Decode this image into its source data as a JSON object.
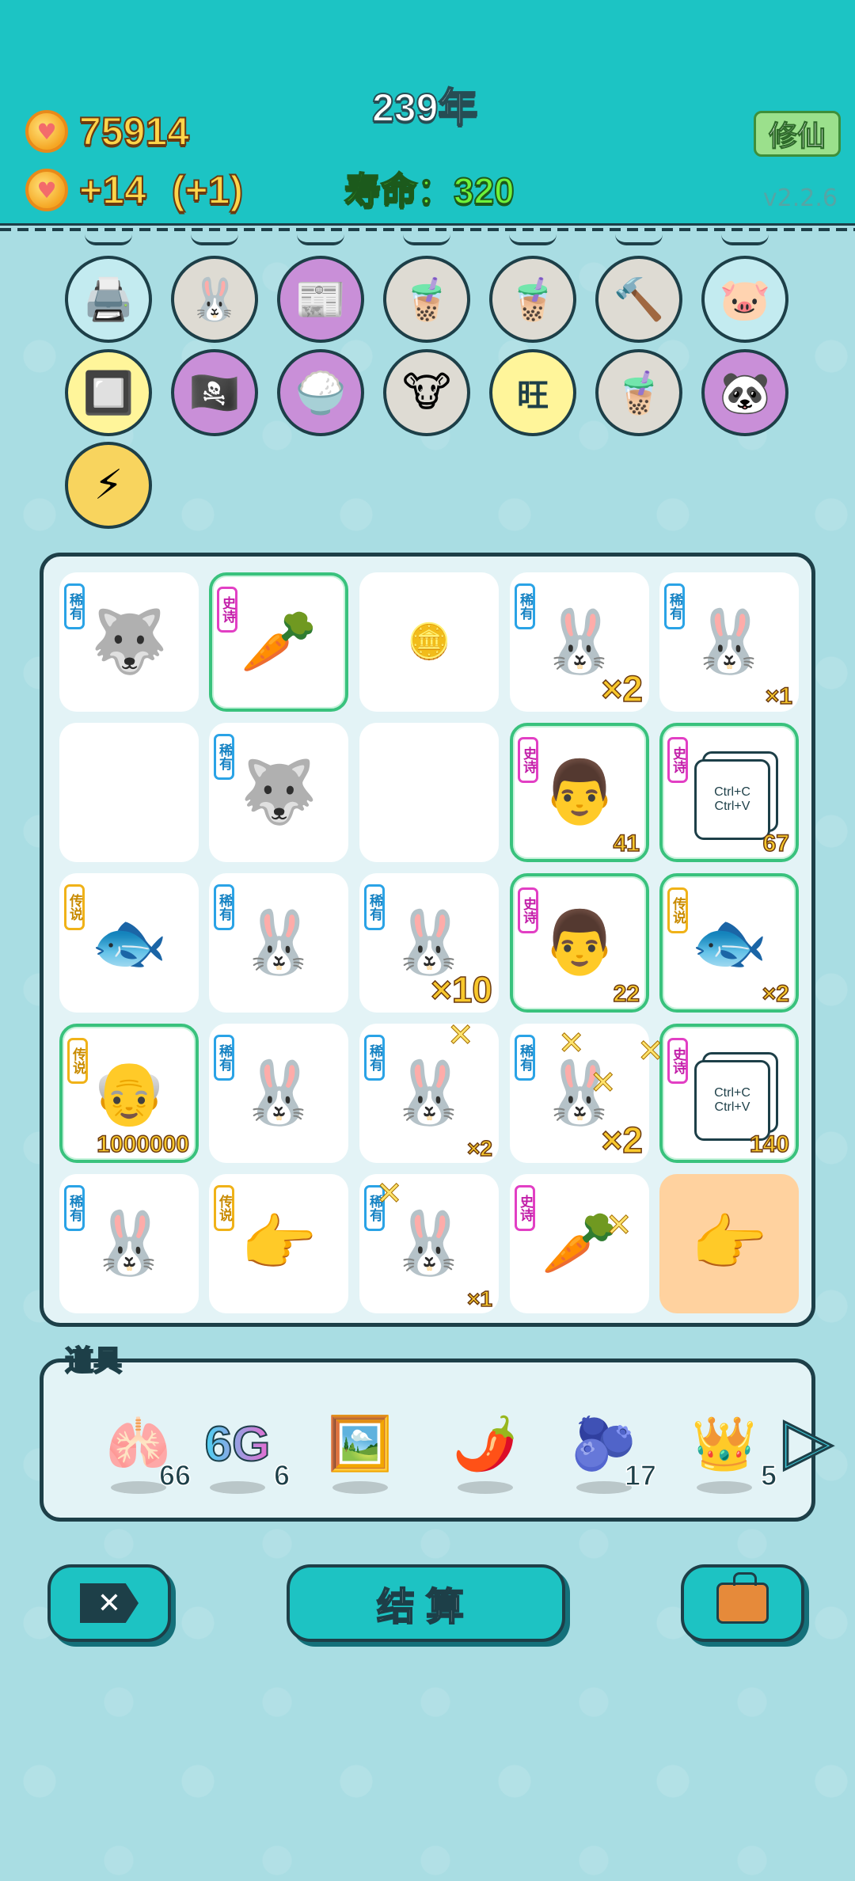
{
  "header": {
    "coins": "75914",
    "income": "+14",
    "bonus": "(+1)",
    "year": "239年",
    "lifespan_label": "寿命：",
    "lifespan_value": "320",
    "cultivate_label": "修仙",
    "version": "v2.2.6"
  },
  "relics": [
    {
      "name": "printer-icon",
      "glyph": "🖨️",
      "bg": "blue"
    },
    {
      "name": "rabbit-coin-icon",
      "glyph": "🐰",
      "bg": "grey"
    },
    {
      "name": "time-magazine-icon",
      "glyph": "📰",
      "bg": "purple"
    },
    {
      "name": "milk-tea-icon",
      "glyph": "🧋",
      "bg": "grey"
    },
    {
      "name": "milk-tea-icon",
      "glyph": "🧋",
      "bg": "grey"
    },
    {
      "name": "hammer-icon",
      "glyph": "🔨",
      "bg": "grey"
    },
    {
      "name": "piggy-bank-icon",
      "glyph": "🐷",
      "bg": "blue"
    },
    {
      "name": "cpu-chip-icon",
      "glyph": "🔲",
      "bg": "yellow"
    },
    {
      "name": "eyepatch-icon",
      "glyph": "🏴‍☠️",
      "bg": "purple"
    },
    {
      "name": "rice-bowl-icon",
      "glyph": "🍚",
      "bg": "purple"
    },
    {
      "name": "cow-figures-icon",
      "glyph": "🐮",
      "bg": "grey"
    },
    {
      "name": "wang-wang-icon",
      "glyph": "旺",
      "bg": "yellow"
    },
    {
      "name": "milk-tea-icon",
      "glyph": "🧋",
      "bg": "grey"
    },
    {
      "name": "panda-icon",
      "glyph": "🐼",
      "bg": "purple"
    },
    {
      "name": "lightning-icon",
      "glyph": "⚡",
      "bg": "gold"
    }
  ],
  "rarity_labels": {
    "rare": "稀有",
    "epic": "史诗",
    "legend": "传说"
  },
  "board": [
    [
      {
        "name": "wolf-icon",
        "glyph": "🐺",
        "rarity": "rare",
        "num": "",
        "epic": false
      },
      {
        "name": "carrot-icon",
        "glyph": "🥕",
        "rarity": "epic",
        "num": "",
        "epic": true
      },
      {
        "name": "coin-icon",
        "glyph": "🪙",
        "rarity": "",
        "num": "",
        "epic": false,
        "small": true
      },
      {
        "name": "rabbit-icon",
        "glyph": "🐰",
        "rarity": "rare",
        "num": "×2",
        "big": true
      },
      {
        "name": "rabbit-icon",
        "glyph": "🐰",
        "rarity": "rare",
        "num": "×1"
      }
    ],
    [
      {
        "name": "empty-cell",
        "glyph": "",
        "rarity": "",
        "num": ""
      },
      {
        "name": "wolf-icon",
        "glyph": "🐺",
        "rarity": "rare",
        "num": ""
      },
      {
        "name": "empty-cell",
        "glyph": "",
        "rarity": "",
        "num": ""
      },
      {
        "name": "worker-face-icon",
        "glyph": "👨",
        "rarity": "epic",
        "num": "41",
        "epic": true
      },
      {
        "name": "ctrl-cv-card",
        "glyph": "copy",
        "rarity": "epic",
        "num": "67",
        "epic": true
      }
    ],
    [
      {
        "name": "koi-fish-icon",
        "glyph": "🐟",
        "rarity": "legend",
        "num": ""
      },
      {
        "name": "rabbit-icon",
        "glyph": "🐰",
        "rarity": "rare",
        "num": ""
      },
      {
        "name": "rabbit-icon",
        "glyph": "🐰",
        "rarity": "rare",
        "num": "×10",
        "big": true
      },
      {
        "name": "worker-face-icon",
        "glyph": "👨",
        "rarity": "epic",
        "num": "22",
        "epic": true
      },
      {
        "name": "koi-fish-icon",
        "glyph": "🐟",
        "rarity": "legend",
        "num": "×2",
        "epic": true
      }
    ],
    [
      {
        "name": "old-man-face-icon",
        "glyph": "👴",
        "rarity": "legend",
        "num": "1000000",
        "epic": true
      },
      {
        "name": "rabbit-icon",
        "glyph": "🐰",
        "rarity": "rare",
        "num": ""
      },
      {
        "name": "rabbit-icon",
        "glyph": "🐰",
        "rarity": "rare",
        "num": "×2",
        "sm": true
      },
      {
        "name": "rabbit-icon",
        "glyph": "🐰",
        "rarity": "rare",
        "num": "×2",
        "big": true
      },
      {
        "name": "ctrl-cv-card",
        "glyph": "copy",
        "rarity": "epic",
        "num": "140",
        "epic": true
      }
    ],
    [
      {
        "name": "rabbit-icon",
        "glyph": "🐰",
        "rarity": "rare",
        "num": ""
      },
      {
        "name": "pointing-hand-icon",
        "glyph": "👉",
        "rarity": "legend",
        "num": ""
      },
      {
        "name": "rabbit-icon",
        "glyph": "🐰",
        "rarity": "rare",
        "num": "×1",
        "sm": true
      },
      {
        "name": "carrot-icon",
        "glyph": "🥕",
        "rarity": "epic",
        "num": ""
      },
      {
        "name": "pointing-hand-icon",
        "glyph": "👉",
        "rarity": "",
        "num": "",
        "highlight": true
      }
    ]
  ],
  "copy_card": {
    "line1": "Ctrl+C",
    "line2": "Ctrl+V"
  },
  "items_label": "道具",
  "items": [
    {
      "name": "liver-icon",
      "glyph": "🫁",
      "count": "66"
    },
    {
      "name": "6g-icon",
      "glyph": "6G",
      "count": "6"
    },
    {
      "name": "framed-picture-icon",
      "glyph": "🖼️",
      "count": ""
    },
    {
      "name": "chili-pepper-icon",
      "glyph": "🌶️",
      "count": ""
    },
    {
      "name": "blueberry-icon",
      "glyph": "🫐",
      "count": "17"
    },
    {
      "name": "crown-icon",
      "glyph": "👑",
      "count": "5"
    }
  ],
  "buttons": {
    "settle": "结算",
    "skip": "✕"
  }
}
